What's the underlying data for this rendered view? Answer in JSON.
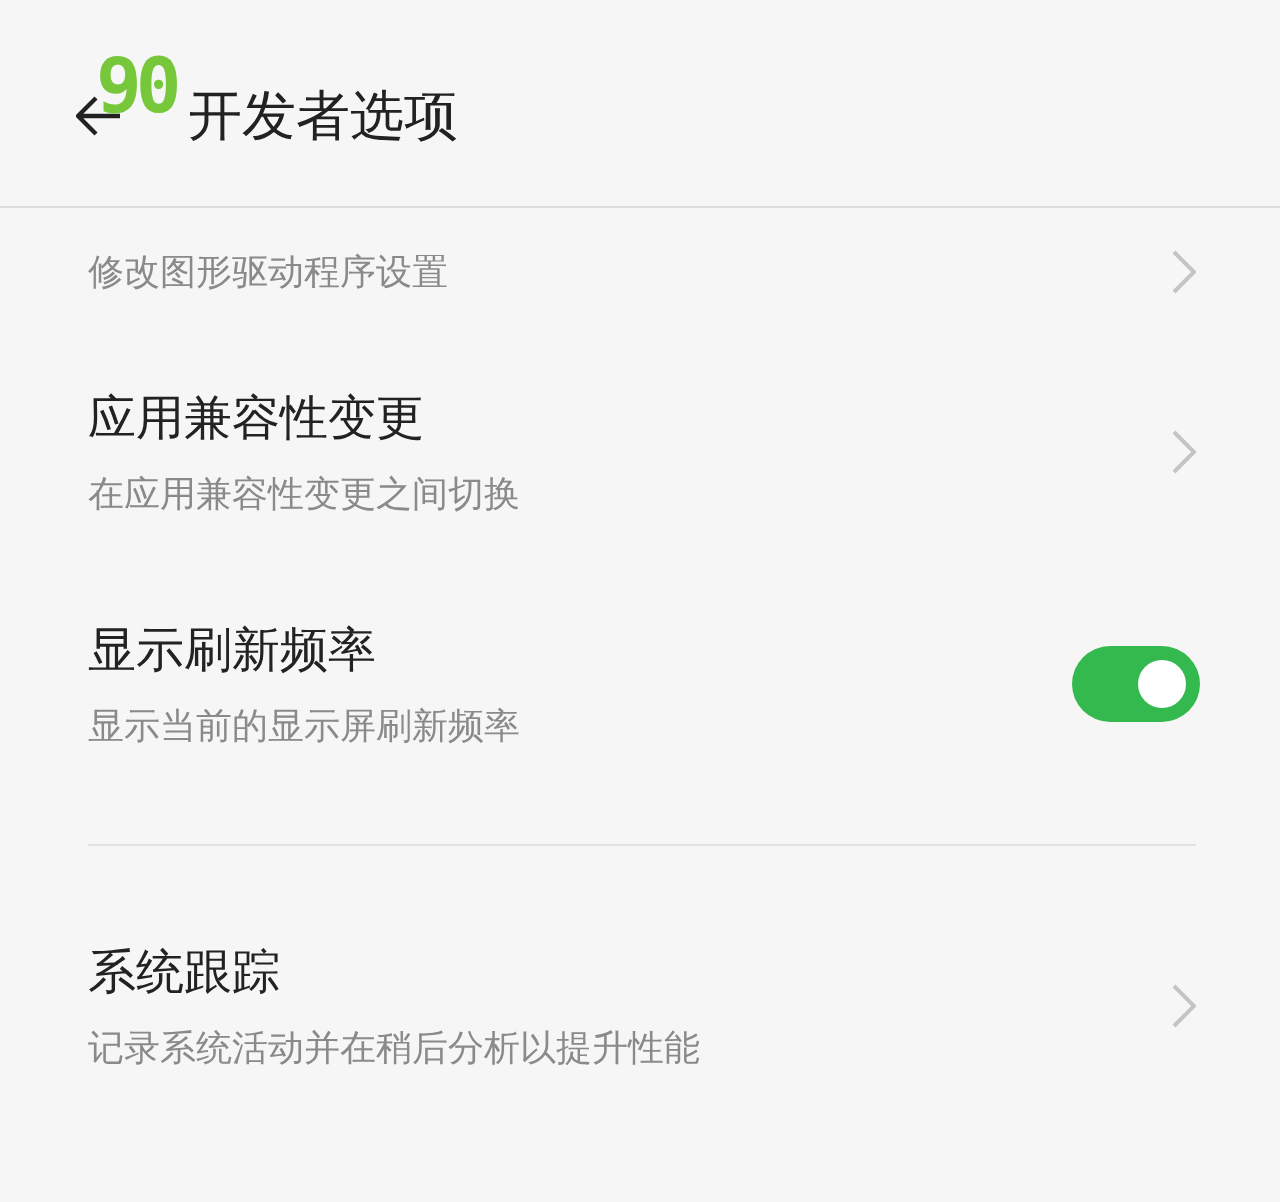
{
  "overlay": {
    "refresh_rate": "90"
  },
  "header": {
    "title": "开发者选项"
  },
  "items": [
    {
      "kind": "link",
      "subtitle": "修改图形驱动程序设置"
    },
    {
      "kind": "link",
      "title": "应用兼容性变更",
      "subtitle": "在应用兼容性变更之间切换"
    },
    {
      "kind": "toggle",
      "title": "显示刷新频率",
      "subtitle": "显示当前的显示屏刷新频率",
      "on": true
    },
    {
      "kind": "divider"
    },
    {
      "kind": "link",
      "title": "系统跟踪",
      "subtitle": "记录系统活动并在稍后分析以提升性能"
    }
  ]
}
